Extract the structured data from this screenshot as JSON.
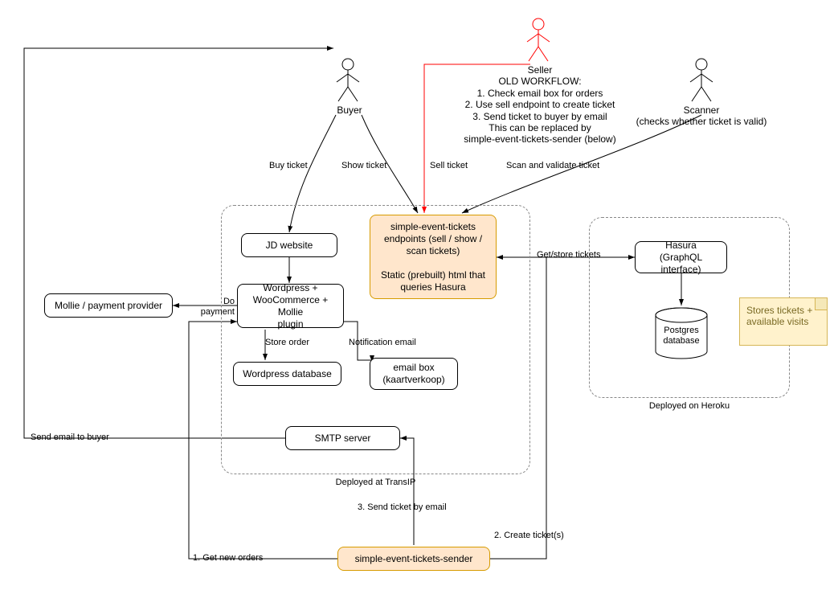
{
  "actors": {
    "buyer": {
      "label": "Buyer"
    },
    "seller": {
      "label": "Seller",
      "workflow_header": "OLD WORKFLOW:",
      "workflow_1": "1. Check email box for orders",
      "workflow_2": "2. Use sell endpoint to create ticket",
      "workflow_3": "3. Send ticket to buyer by email",
      "workflow_note_1": "This can be replaced by",
      "workflow_note_2": "simple-event-tickets-sender (below)"
    },
    "scanner": {
      "label": "Scanner",
      "sub": "(checks whether ticket is valid)"
    }
  },
  "boxes": {
    "jd_website": "JD website",
    "wordpress_stack": "Wordpress +\nWooCommerce + Mollie\nplugin",
    "mollie": "Mollie / payment provider",
    "wp_db": "Wordpress database",
    "email_box": "email box\n(kaartverkoop)",
    "smtp": "SMTP server",
    "set_endpoints": "simple-event-tickets\nendpoints (sell / show /\nscan tickets)\n\nStatic (prebuilt) html that\nqueries Hasura",
    "hasura": "Hasura\n(GraphQL interface)",
    "postgres": "Postgres\ndatabase",
    "set_sender": "simple-event-tickets-sender"
  },
  "groups": {
    "transip": "Deployed at TransIP",
    "heroku": "Deployed on Heroku"
  },
  "note": {
    "text": "Stores tickets +\navailable visits"
  },
  "edges": {
    "buy_ticket": "Buy ticket",
    "show_ticket": "Show ticket",
    "sell_ticket": "Sell ticket",
    "scan_validate": "Scan and validate ticket",
    "do_payment": "Do\npayment",
    "store_order": "Store order",
    "notification_email": "Notification email",
    "get_store_tickets": "Get/store tickets",
    "send_email_to_buyer": "Send email to buyer",
    "get_new_orders": "1. Get new orders",
    "create_tickets": "2. Create ticket(s)",
    "send_ticket_email": "3. Send ticket by email"
  },
  "colors": {
    "seller_stroke": "#ff0000",
    "box_orange_fill": "#ffe6cc",
    "box_orange_stroke": "#d79b00",
    "note_fill": "#fff2cc",
    "note_stroke": "#d6b656"
  }
}
